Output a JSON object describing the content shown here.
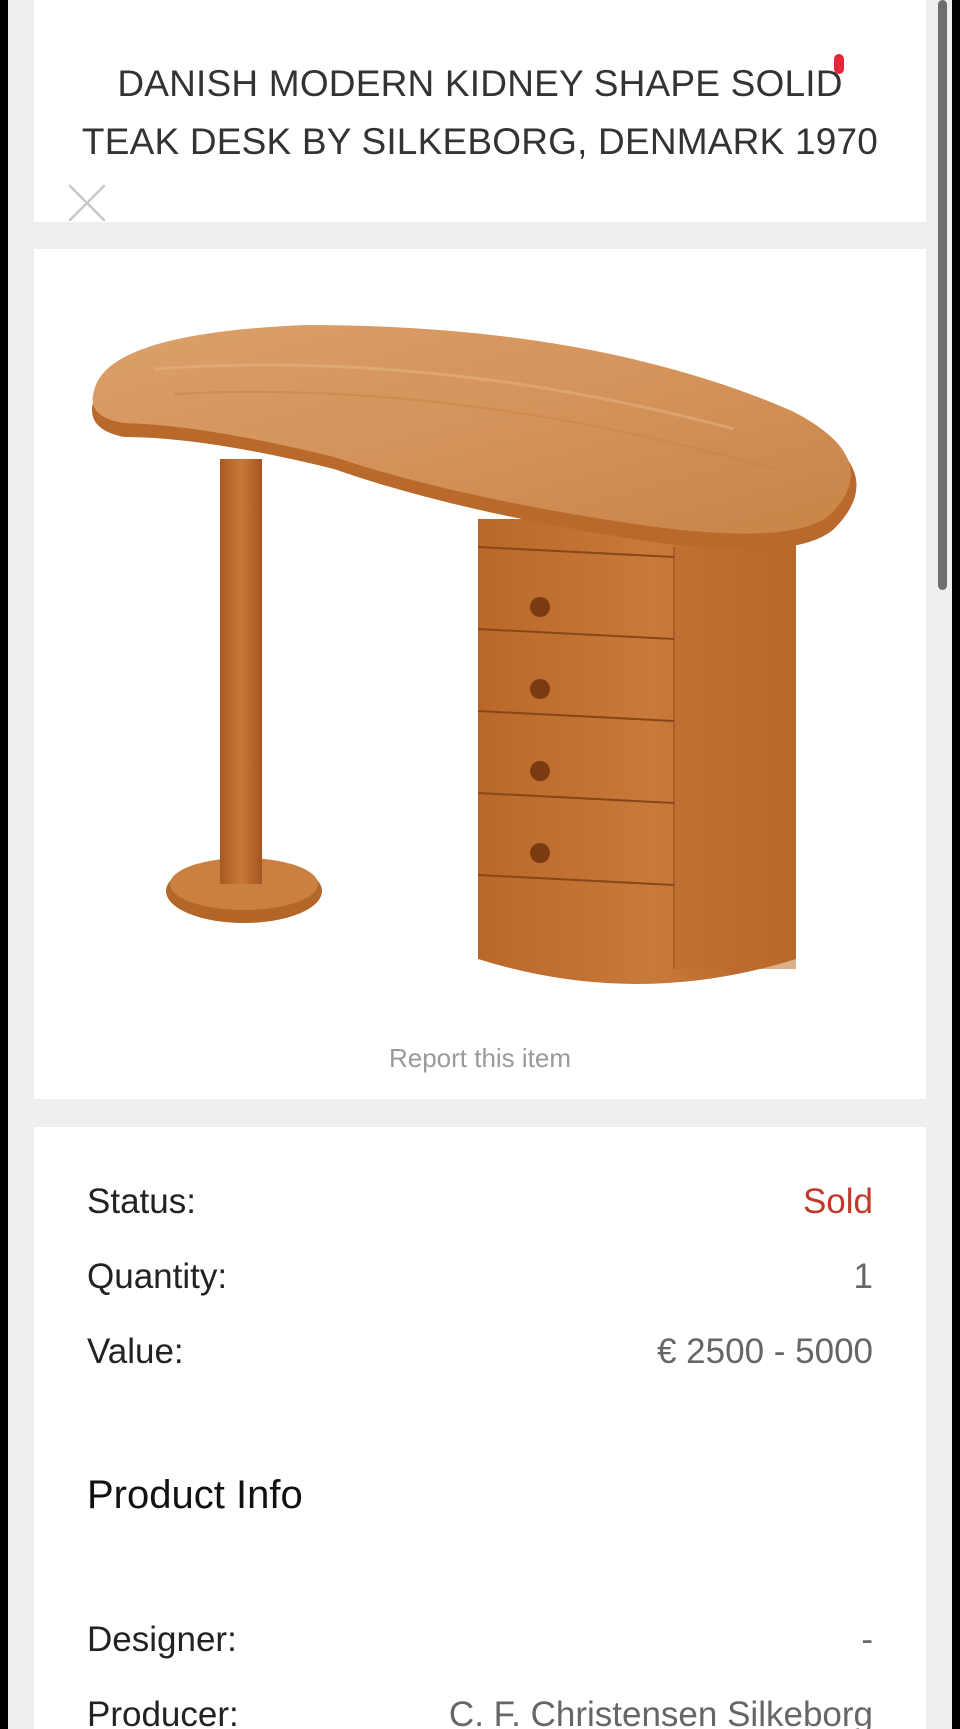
{
  "listing": {
    "title": "DANISH MODERN KIDNEY SHAPE SOLID TEAK DESK BY SILKEBORG, DENMARK 1970",
    "report_label": "Report this item"
  },
  "details": {
    "status_label": "Status:",
    "status_value": "Sold",
    "quantity_label": "Quantity:",
    "quantity_value": "1",
    "value_label": "Value:",
    "value_value": "€ 2500 - 5000"
  },
  "product_info": {
    "heading": "Product Info",
    "designer_label": "Designer:",
    "designer_value": "-",
    "producer_label": "Producer:",
    "producer_value": "C. F. Christensen Silkeborg"
  },
  "icons": {
    "close": "close-icon",
    "notification": "notification-dot-icon"
  },
  "colors": {
    "sold": "#c0392b",
    "accent_dot": "#e8263a",
    "teak": "#c97a3a"
  }
}
